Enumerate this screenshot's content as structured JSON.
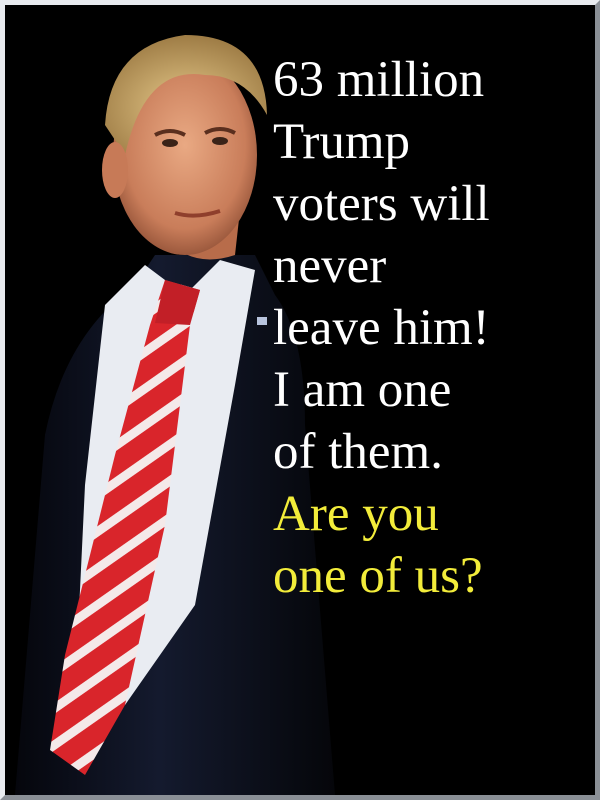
{
  "poster": {
    "lines": [
      "63 million",
      "Trump",
      "voters will",
      "never",
      "leave him!",
      "I am one",
      "of them."
    ],
    "question_lines": [
      "Are you",
      "one of us?"
    ]
  },
  "colors": {
    "background": "#000000",
    "text_white": "#ffffff",
    "text_yellow": "#f2ec3a",
    "tie_red": "#d9252b",
    "suit": "#0d1020"
  },
  "image": {
    "subject": "portrait-photo"
  }
}
